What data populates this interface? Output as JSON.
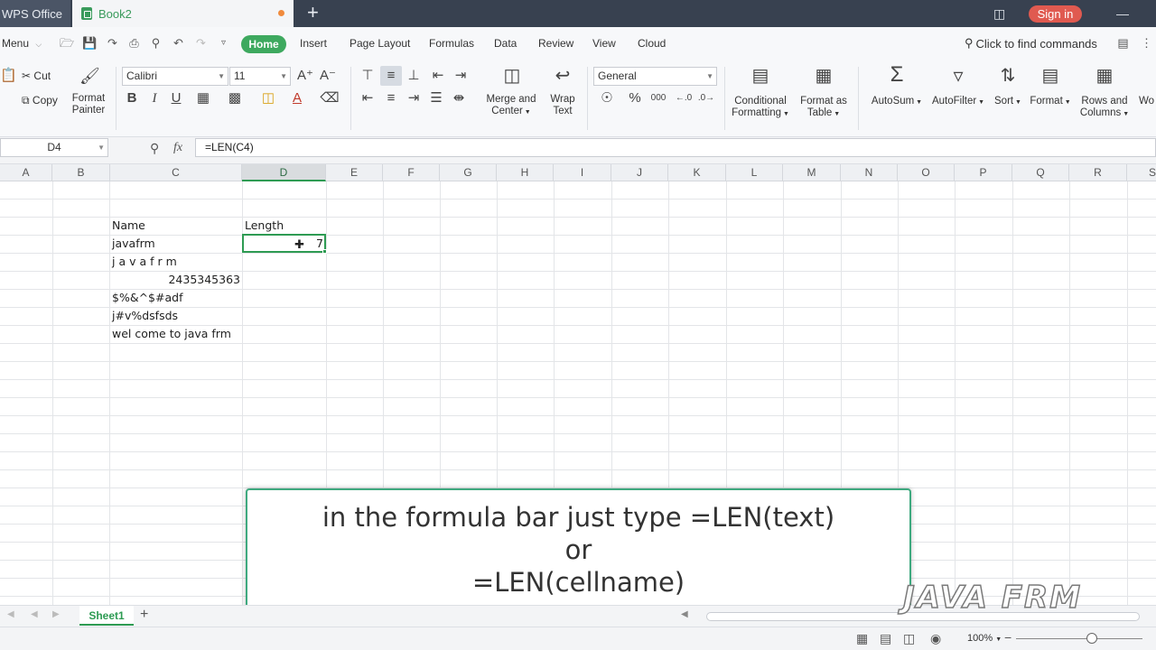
{
  "titlebar": {
    "app_tab": "WPS Office",
    "doc_tab": "Book2",
    "sign_in": "Sign in"
  },
  "menubar": {
    "menu_label": "Menu",
    "tabs": [
      "Home",
      "Insert",
      "Page Layout",
      "Formulas",
      "Data",
      "Review",
      "View",
      "Cloud"
    ],
    "search_placeholder": "Click to find commands"
  },
  "ribbon": {
    "cut": "Cut",
    "copy": "Copy",
    "paste": "Paste",
    "format_painter_1": "Format",
    "format_painter_2": "Painter",
    "font_name": "Calibri",
    "font_size": "11",
    "bold": "B",
    "italic": "I",
    "underline": "U",
    "merge_1": "Merge and",
    "merge_2": "Center",
    "wrap_1": "Wrap",
    "wrap_2": "Text",
    "number_format": "General",
    "percent": "%",
    "thousands": "000",
    "cond_1": "Conditional",
    "cond_2": "Formatting",
    "table_1": "Format as",
    "table_2": "Table",
    "autosum": "AutoSum",
    "autofilter": "AutoFilter",
    "sort": "Sort",
    "format": "Format",
    "rowcol_1": "Rows and",
    "rowcol_2": "Columns",
    "worksheet": "Wo"
  },
  "formula_bar": {
    "name_box": "D4",
    "fx": "fx",
    "formula": "=LEN(C4)"
  },
  "columns": [
    "A",
    "B",
    "C",
    "D",
    "E",
    "F",
    "G",
    "H",
    "I",
    "J",
    "K",
    "L",
    "M",
    "N",
    "O",
    "P",
    "Q",
    "R",
    "S"
  ],
  "cells": {
    "header_name": "Name",
    "header_length": "Length",
    "c4": "javafrm",
    "c5": "j a v a f r m",
    "c6": "2435345363",
    "c7": "$%&^$#adf",
    "c8": "j#v%dsfsds",
    "c9": "wel come to java frm",
    "d4": "7"
  },
  "caption": {
    "line1": "in the formula bar just type =LEN(text)",
    "line2": "or",
    "line3": "=LEN(cellname)"
  },
  "sheets": {
    "active": "Sheet1"
  },
  "status": {
    "zoom": "100%"
  },
  "watermark": "JAVA FRM",
  "colors": {
    "accent_green": "#3ea95f",
    "titlebar": "#384150",
    "sign_in_red": "#e05a50"
  }
}
